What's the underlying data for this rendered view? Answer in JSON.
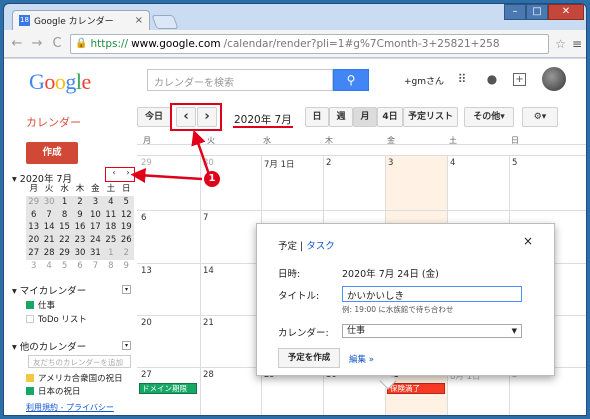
{
  "browser": {
    "tab_title": "Google カレンダー",
    "url_scheme": "https://",
    "url_host": "www.google.com",
    "url_rest": "/calendar/render?pli=1#g%7Cmonth-3+25821+258"
  },
  "header": {
    "logo": "Google",
    "search_placeholder": "カレンダーを検索",
    "user": "+gmさん"
  },
  "app": {
    "title": "カレンダー",
    "create_label": "作成"
  },
  "toolbar": {
    "today": "今日",
    "prev": "‹",
    "next": "›",
    "current": "2020年 7月",
    "views": [
      "日",
      "週",
      "月",
      "4日",
      "予定リスト"
    ],
    "more": "その他▾",
    "settings": "⚙▾"
  },
  "mini_calendar": {
    "title": "2020年 7月",
    "dow": [
      "月",
      "火",
      "水",
      "木",
      "金",
      "土",
      "日"
    ],
    "weeks": [
      [
        "29",
        "30",
        "1",
        "2",
        "3",
        "4",
        "5"
      ],
      [
        "6",
        "7",
        "8",
        "9",
        "10",
        "11",
        "12"
      ],
      [
        "13",
        "14",
        "15",
        "16",
        "17",
        "18",
        "19"
      ],
      [
        "20",
        "21",
        "22",
        "23",
        "24",
        "25",
        "26"
      ],
      [
        "27",
        "28",
        "29",
        "30",
        "31",
        "1",
        "2"
      ],
      [
        "3",
        "4",
        "5",
        "6",
        "7",
        "8",
        "9"
      ]
    ]
  },
  "sidebar": {
    "my_calendars": "マイカレンダー",
    "my_items": [
      {
        "name": "仕事",
        "color": "#16a765"
      },
      {
        "name": "ToDo リスト",
        "color": "#ffffff"
      }
    ],
    "other_calendars": "他のカレンダー",
    "add_placeholder": "友だちのカレンダーを追加",
    "other_items": [
      {
        "name": "アメリカ合衆国の祝日",
        "color": "#f2c744"
      },
      {
        "name": "日本の祝日",
        "color": "#16a765"
      }
    ],
    "footer_terms": "利用規約",
    "footer_privacy": "プライバシー"
  },
  "month_grid": {
    "dow": [
      "月",
      "火",
      "水",
      "木",
      "金",
      "土",
      "日"
    ],
    "week1": [
      "29",
      "30",
      "7月 1日",
      "2",
      "3",
      "4",
      "5"
    ],
    "rows_day1": [
      "6",
      "13",
      "20"
    ],
    "rows_day2": [
      "7",
      "14",
      "21"
    ],
    "last_row": [
      "27",
      "28",
      "29",
      "30",
      "31",
      "8月 1日",
      "2"
    ],
    "events": [
      {
        "label": "ドメイン期限",
        "color": "#16a765",
        "border": "#0d7a45"
      },
      {
        "label": "保険満了",
        "color": "#f83a22",
        "border": "#b3271a"
      }
    ]
  },
  "popup": {
    "tab_event": "予定",
    "tab_task": "タスク",
    "close": "×",
    "when_label": "日時:",
    "when_value": "2020年 7月 24日 (金)",
    "title_label": "タイトル:",
    "title_value": "かいかいしき",
    "title_hint": "例: 19:00 に水族館で待ち合わせ",
    "calendar_label": "カレンダー:",
    "calendar_value": "仕事",
    "create_button": "予定を作成",
    "edit_link": "編集 »"
  },
  "annotation": {
    "badge": "1",
    "color": "#e0001a"
  }
}
